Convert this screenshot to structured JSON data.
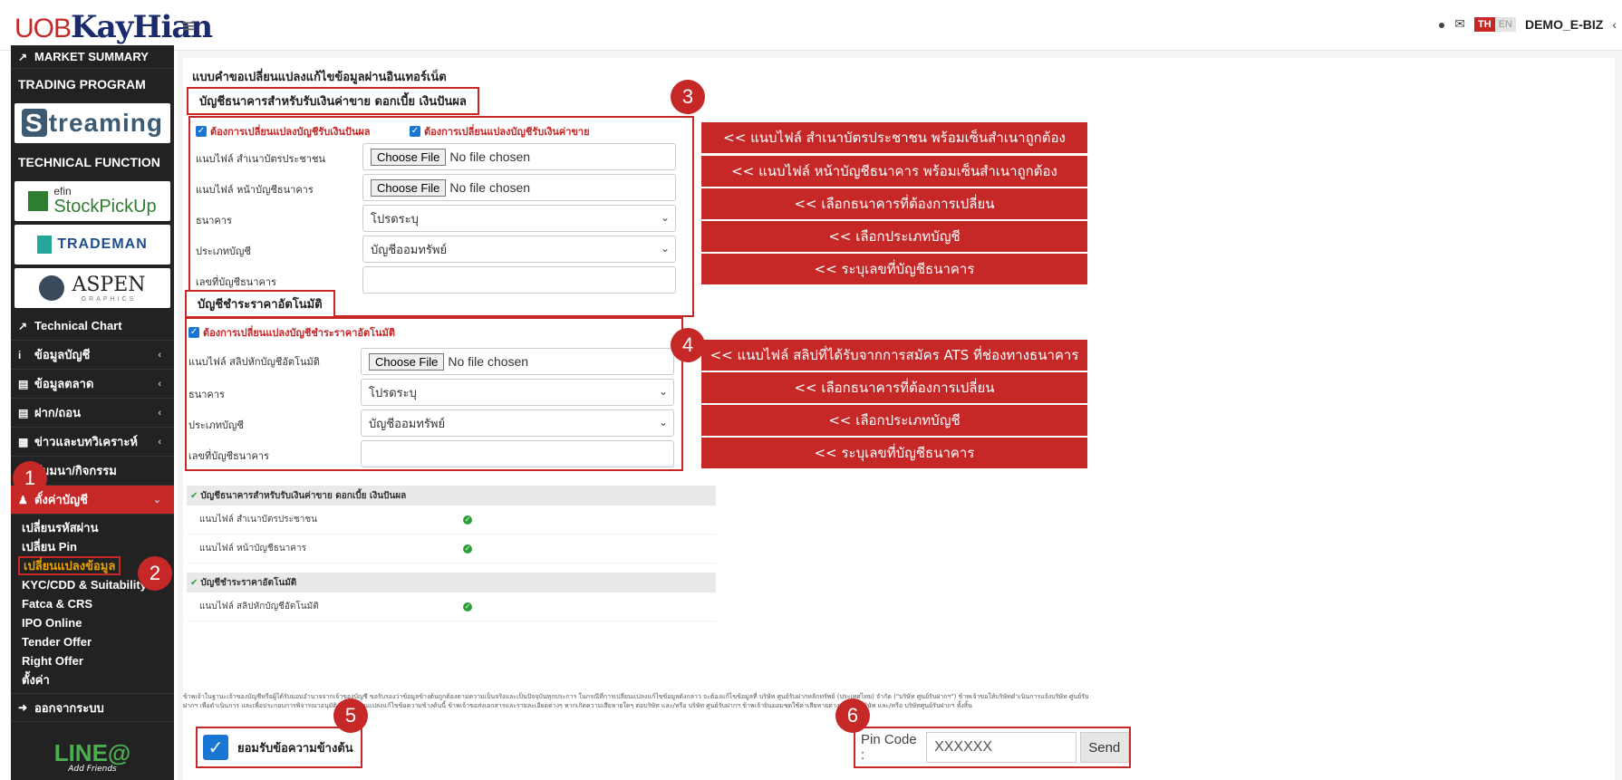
{
  "brand": {
    "logo_prefix": "UOB",
    "logo_name": "KayHian"
  },
  "topbar": {
    "lang_th": "TH",
    "lang_en": "EN",
    "username": "DEMO_E-BIZ",
    "user_icon": "user-circle-icon",
    "mail_icon": "envelope-icon"
  },
  "sidebar": {
    "market_summary": "MARKET SUMMARY",
    "trading_program": "TRADING PROGRAM",
    "streaming": "treaming",
    "technical_function": "TECHNICAL FUNCTION",
    "efin_small": "efin",
    "efin_big": "StockPickUp",
    "trademan": "TRADEMAN",
    "aspen": "ASPEN",
    "aspen_sub": "GRAPHICS",
    "technical_chart": "Technical Chart",
    "items": [
      {
        "label": "ข้อมูลบัญชี"
      },
      {
        "label": "ข้อมูลตลาด"
      },
      {
        "label": "ฝาก/ถอน"
      },
      {
        "label": "ข่าวและบทวิเคราะห์"
      },
      {
        "label": "สัมมนา/กิจกรรม"
      },
      {
        "label": "ตั้งค่าบัญชี"
      }
    ],
    "sub_items": [
      {
        "label": "เปลี่ยนรหัสผ่าน"
      },
      {
        "label": "เปลี่ยน Pin"
      },
      {
        "label": "เปลี่ยนแปลงข้อมูล"
      },
      {
        "label": "KYC/CDD & Suitability"
      },
      {
        "label": "Fatca & CRS"
      },
      {
        "label": "IPO Online"
      },
      {
        "label": "Tender Offer"
      },
      {
        "label": "Right Offer"
      },
      {
        "label": "ตั้งค่า"
      }
    ],
    "logout": "ออกจากระบบ",
    "line_main": "LINE@",
    "line_sub": "Add Friends"
  },
  "page": {
    "title": "แบบคำขอเปลี่ยนแปลงแก้ไขข้อมูลผ่านอินเทอร์เน็ต",
    "section1": "บัญชีธนาคารสำหรับรับเงินค่าขาย ดอกเบี้ย เงินปันผล",
    "section2": "บัญชีชำระราคาอัตโนมัติ"
  },
  "form1": {
    "chk_dividend": "ต้องการเปลี่ยนแปลงบัญชีรับเงินปันผล",
    "chk_sale": "ต้องการเปลี่ยนแปลงบัญชีรับเงินค่าขาย",
    "label_idcard": "แนบไฟล์ สำเนาบัตรประชาชน",
    "label_bookbank": "แนบไฟล์ หน้าบัญชีธนาคาร",
    "label_bank": "ธนาคาร",
    "label_acc_type": "ประเภทบัญชี",
    "label_acc_no": "เลขที่บัญชีธนาคาร",
    "file_btn": "Choose File",
    "no_file": "No file chosen",
    "bank_value": "โปรดระบุ",
    "acc_type_value": "บัญชีออมทรัพย์",
    "acc_no_value": ""
  },
  "form2": {
    "chk_ats": "ต้องการเปลี่ยนแปลงบัญชีชำระราคาอัตโนมัติ",
    "label_slip": "แนบไฟล์ สลิปหักบัญชีอัตโนมัติ",
    "label_bank": "ธนาคาร",
    "label_acc_type": "ประเภทบัญชี",
    "label_acc_no": "เลขที่บัญชีธนาคาร",
    "file_btn": "Choose File",
    "no_file": "No file chosen",
    "bank_value": "โปรดระบุ",
    "acc_type_value": "บัญชีออมทรัพย์",
    "acc_no_value": ""
  },
  "hints1": [
    "<< แนบไฟล์ สำเนาบัตรประชาชน พร้อมเซ็นสำเนาถูกต้อง",
    "<< แนบไฟล์ หน้าบัญชีธนาคาร พร้อมเซ็นสำเนาถูกต้อง",
    "<< เลือกธนาคารที่ต้องการเปลี่ยน",
    "<< เลือกประเภทบัญชี",
    "<< ระบุเลขที่บัญชีธนาคาร"
  ],
  "hints2": [
    "<< แนบไฟล์ สลิปที่ได้รับจากการสมัคร ATS ที่ช่องทางธนาคาร",
    "<< เลือกธนาคารที่ต้องการเปลี่ยน",
    "<< เลือกประเภทบัญชี",
    "<< ระบุเลขที่บัญชีธนาคาร"
  ],
  "summary": {
    "hdr1": "บัญชีธนาคารสำหรับรับเงินค่าขาย ดอกเบี้ย เงินปันผล",
    "row1": "แนบไฟล์ สำเนาบัตรประชาชน",
    "row2": "แนบไฟล์ หน้าบัญชีธนาคาร",
    "hdr2": "บัญชีชำระราคาอัตโนมัติ",
    "row3": "แนบไฟล์ สลิปหักบัญชีอัตโนมัติ"
  },
  "disclaimer": "ข้าพเจ้าในฐานะเจ้าของบัญชีหรือผู้ได้รับมอบอำนาจจากเจ้าของบัญชี ขอรับรองว่าข้อมูลข้างต้นถูกต้องตามความเป็นจริงและเป็นปัจจุบันทุกประการ ในกรณีที่การเปลี่ยนแปลงแก้ไขข้อมูลดังกล่าว จะต้องแก้ไขข้อมูลที่ บริษัท ศูนย์รับฝากหลักทรัพย์ (ประเทศไทย) จำกัด (\"บริษัท ศูนย์รับฝากฯ\") ข้าพเจ้าขอให้บริษัทดำเนินการแจ้งบริษัท ศูนย์รับฝากฯ เพื่อดำเนินการ และเพื่อประกอบการพิจารณาอนุมัติ การเปลี่ยนแปลงแก้ไขข้อความข้างต้นนี้ ข้าพเจ้าขอส่งเอกสารและรายละเอียดต่างๆ หากเกิดความเสียหายใดๆ ต่อบริษัท และ/หรือ บริษัท ศูนย์รับฝากฯ ข้าพเจ้ายินยอมชดใช้ค่าเสียหายต่างๆ ให้แก่บริษัท และ/หรือ บริษัทศูนย์รับฝากฯ ทั้งสิ้น",
  "accept": {
    "label": "ยอมรับข้อความข้างต้น"
  },
  "pin": {
    "label": "Pin Code :",
    "value": "XXXXXX",
    "send": "Send"
  },
  "badges": [
    "1",
    "2",
    "3",
    "4",
    "5",
    "6"
  ]
}
